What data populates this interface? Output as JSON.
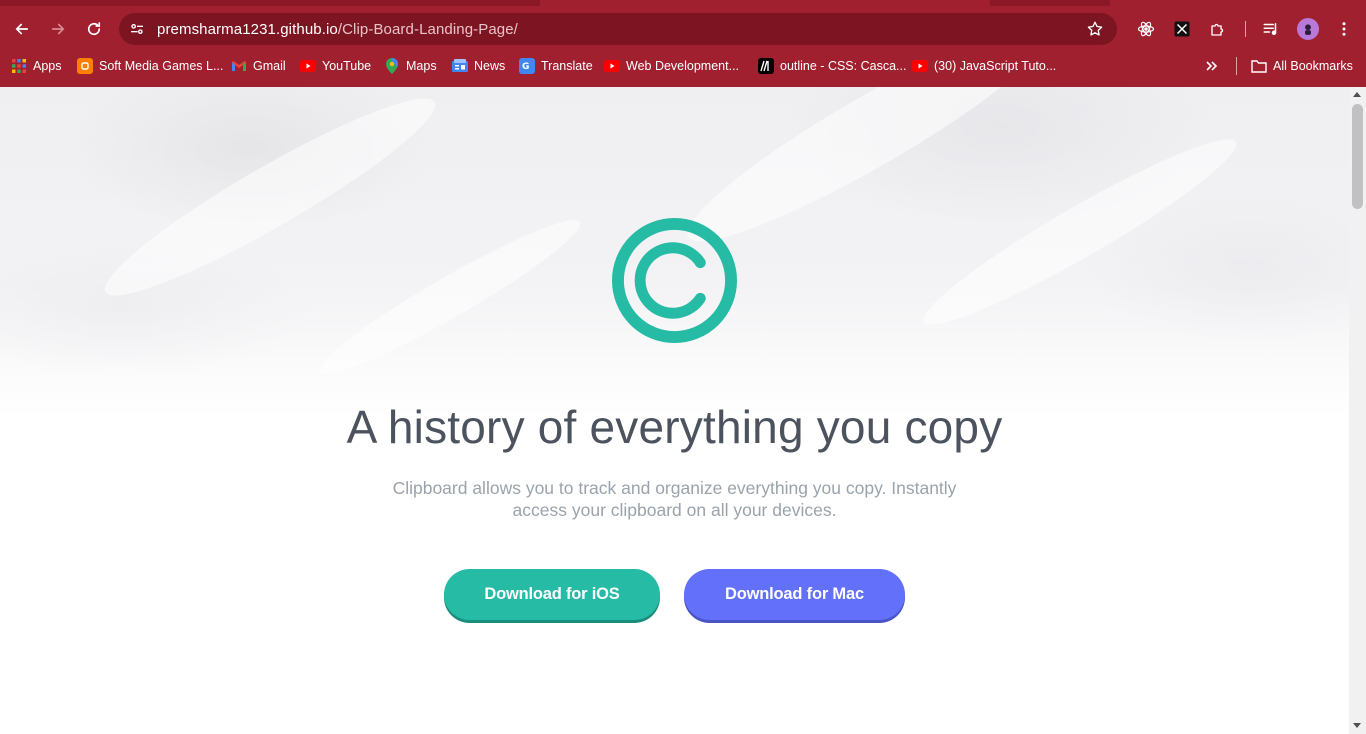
{
  "browser": {
    "url_domain": "premsharma1231.github.io",
    "url_path": "/Clip-Board-Landing-Page/",
    "accent_color": "#a1202f"
  },
  "bookmarks": {
    "items": [
      {
        "label": "Apps",
        "icon": "apps-grid-icon"
      },
      {
        "label": "Soft Media Games L...",
        "icon": "blogger-icon"
      },
      {
        "label": "Gmail",
        "icon": "gmail-icon"
      },
      {
        "label": "YouTube",
        "icon": "youtube-icon"
      },
      {
        "label": "Maps",
        "icon": "maps-icon"
      },
      {
        "label": "News",
        "icon": "news-icon"
      },
      {
        "label": "Translate",
        "icon": "translate-icon"
      },
      {
        "label": "Web Development...",
        "icon": "youtube-icon"
      },
      {
        "label": "outline - CSS: Casca...",
        "icon": "mdn-icon"
      },
      {
        "label": "(30) JavaScript Tuto...",
        "icon": "youtube-icon"
      }
    ],
    "all_bookmarks": "All Bookmarks"
  },
  "hero": {
    "logo_icon": "copyright-logo-icon",
    "logo_color": "#26bba5",
    "title": "A history of everything you copy",
    "subtitle": "Clipboard allows you to track and organize everything you copy. Instantly access your clipboard on all your devices.",
    "ios_button": "Download for iOS",
    "mac_button": "Download for Mac",
    "ios_color": "#26bba5",
    "mac_color": "#6370fa"
  }
}
